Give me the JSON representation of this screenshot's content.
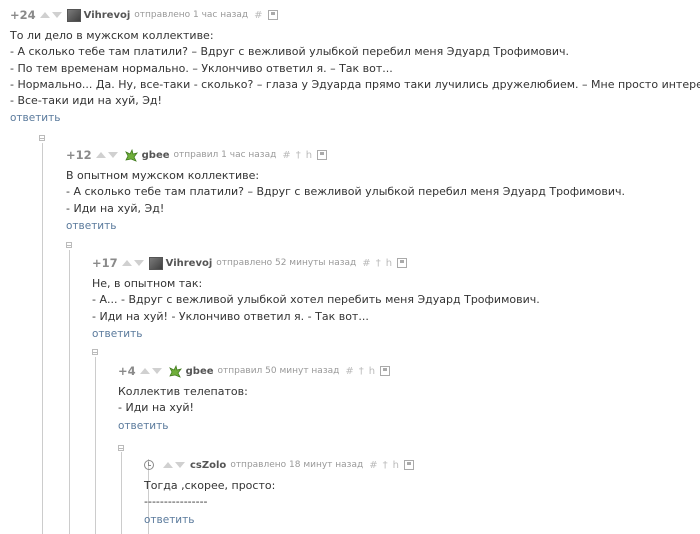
{
  "comments": [
    {
      "rating": "+24",
      "author": "Vihrevoj",
      "meta": "отправлено 1 час назад",
      "avatar": "avatar-photo",
      "lines": [
        "То ли дело в мужском коллективе:",
        "- А сколько тебе там платили? – Вдруг с вежливой улыбкой перебил меня Эдуард Трофимович.",
        "- По тем временам нормально. – Уклончиво ответил я. – Так вот...",
        "- Нормально... Да. Ну, все-таки - сколько? – глаза у Эдуарда прямо таки лучились дружелюбием. – Мне просто интересно.",
        "- Все-таки иди на хуй, Эд!"
      ],
      "reply": "ответить"
    },
    {
      "rating": "+12",
      "author": "gbee",
      "meta": "отправил 1 час назад",
      "avatar": "dragon-avatar",
      "lines": [
        "В опытном мужском коллективе:",
        "- А сколько тебе там платили? – Вдруг с вежливой улыбкой перебил меня Эдуард Трофимович.",
        "- Иди на хуй, Эд!"
      ],
      "reply": "ответить"
    },
    {
      "rating": "+17",
      "author": "Vihrevoj",
      "meta": "отправлено 52 минуты назад",
      "avatar": "avatar-photo",
      "lines": [
        "Не, в опытном так:",
        "- А... - Вдруг с вежливой улыбкой хотел перебить меня Эдуард Трофимович.",
        "- Иди на хуй! - Уклончиво ответил я. - Так вот..."
      ],
      "reply": "ответить"
    },
    {
      "rating": "+4",
      "author": "gbee",
      "meta": "отправил 50 минут назад",
      "avatar": "dragon-avatar",
      "lines": [
        "Коллектив телепатов:",
        "- Иди на хуй!"
      ],
      "reply": "ответить"
    },
    {
      "rating": "",
      "author": "csZolo",
      "meta": "отправлено 18 минут назад",
      "avatar": "clock-icon",
      "lines": [
        "Тогда ,скорее, просто:",
        "----------------"
      ],
      "reply": "ответить"
    }
  ],
  "icons": {
    "link": "#",
    "up": "†",
    "parent": "h"
  },
  "colors": {
    "reply_link": "#5a7a9c",
    "author": "#555555",
    "meta": "#999999"
  }
}
